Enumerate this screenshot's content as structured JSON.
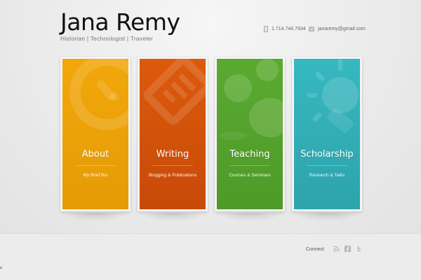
{
  "header": {
    "site_title": "Jana Remy",
    "tagline": "Historian | Technologist | Traveler",
    "phone": "1.714.744.7934",
    "email": "janaremy@gmail.com"
  },
  "cards": [
    {
      "title": "About",
      "subtitle": "My Brief Bio",
      "icon": "clock-icon",
      "color": "#f2a70a"
    },
    {
      "title": "Writing",
      "subtitle": "Blogging & Publications",
      "icon": "pen-icon",
      "color": "#dc5a0c"
    },
    {
      "title": "Teaching",
      "subtitle": "Courses & Seminars",
      "icon": "people-icon",
      "color": "#5aaa30"
    },
    {
      "title": "Scholarship",
      "subtitle": "Research & Talks",
      "icon": "lightbulb-icon",
      "color": "#36b8c0"
    }
  ],
  "footer": {
    "connect_label": "Connect",
    "social_icons": [
      "rss-icon",
      "facebook-icon",
      "twitter-icon"
    ]
  }
}
